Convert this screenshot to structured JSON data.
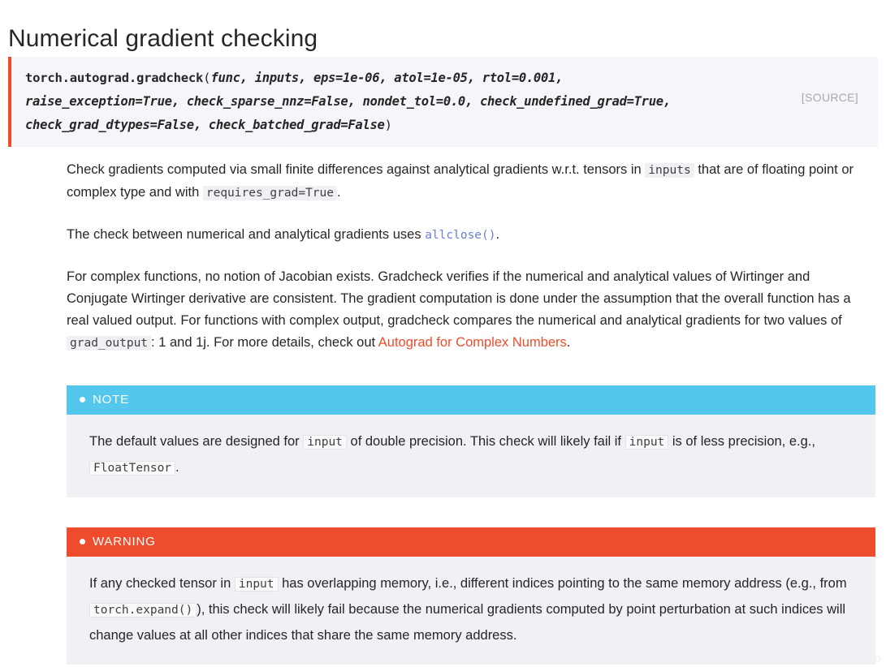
{
  "page": {
    "title": "Numerical gradient checking",
    "watermark": "https://blog.csdn.net/szupup"
  },
  "signature": {
    "qualified_name": "torch.autograd.gradcheck",
    "open_paren": "(",
    "close_paren": ")",
    "args_line1": "func, inputs, eps=1e-06, atol=1e-05, rtol=0.001,",
    "args_line2": "raise_exception=True, check_sparse_nnz=False, nondet_tol=0.0, check_undefined_grad=True,",
    "args_line3": "check_grad_dtypes=False, check_batched_grad=False",
    "source_label": "[SOURCE]"
  },
  "paragraphs": {
    "p1_a": "Check gradients computed via small finite differences against analytical gradients w.r.t. tensors in",
    "p1_code1": "inputs",
    "p1_b": "that are of floating point or complex type and with",
    "p1_code2": "requires_grad=True",
    "p1_c": ".",
    "p2_a": "The check between numerical and analytical gradients uses",
    "p2_link": "allclose()",
    "p2_b": ".",
    "p3_a": "For complex functions, no notion of Jacobian exists. Gradcheck verifies if the numerical and analytical values of Wirtinger and Conjugate Wirtinger derivative are consistent. The gradient computation is done under the assumption that the overall function has a real valued output. For functions with complex output, gradcheck compares the numerical and analytical gradients for two values of",
    "p3_code": "grad_output",
    "p3_b": ": 1 and 1j. For more details, check out",
    "p3_link": "Autograd for Complex Numbers",
    "p3_c": "."
  },
  "note": {
    "title": "NOTE",
    "body_a": "The default values are designed for",
    "body_code1": "input",
    "body_b": "of double precision. This check will likely fail if",
    "body_code2": "input",
    "body_c": "is of less precision, e.g.,",
    "body_code3": "FloatTensor",
    "body_d": "."
  },
  "warning": {
    "title": "WARNING",
    "body_a": "If any checked tensor in",
    "body_code1": "input",
    "body_b": "has overlapping memory, i.e., different indices pointing to the same memory address (e.g., from",
    "body_code2": "torch.expand()",
    "body_c": "), this check will likely fail because the numerical gradients computed by point perturbation at such indices will change values at all other indices that share the same memory address."
  },
  "colors": {
    "accent_red": "#ee4c2c",
    "note_blue": "#54c7ec",
    "code_bg": "#f0f0f5",
    "link_blue": "#6a7fd4"
  }
}
